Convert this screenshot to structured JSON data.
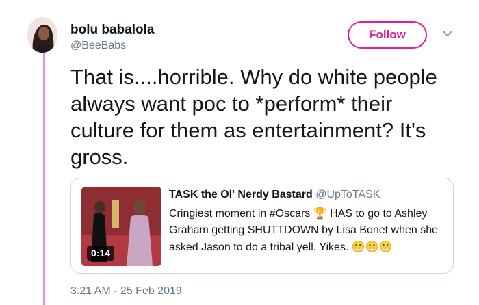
{
  "author": {
    "display_name": "bolu babalola",
    "handle": "@BeeBabs"
  },
  "follow_label": "Follow",
  "tweet": {
    "text": "That is....horrible. Why do white people always want poc to *perform* their culture for them as entertainment?  It's gross.",
    "timestamp": "3:21 AM - 25 Feb 2019"
  },
  "quoted_tweet": {
    "display_name": "TASK the Ol' Nerdy Bastard",
    "handle": "@UpToTASK",
    "text_before_emoji": "Cringiest moment in #Oscars ",
    "oscar_emoji": "🏆",
    "text_after_emoji": " HAS to go to Ashley Graham getting SHUTTDOWN by Lisa Bonet when she asked Jason to do a tribal yell. Yikes. ",
    "grimace_emojis": "😬😬😬",
    "video_duration": "0:14"
  },
  "colors": {
    "accent": "#e81c94",
    "thread_line": "#f08be0",
    "secondary_text": "#657786",
    "border": "#ccd6dd"
  },
  "icons": [
    "avatar-photo",
    "chevron-down-icon",
    "video-thumbnail"
  ]
}
